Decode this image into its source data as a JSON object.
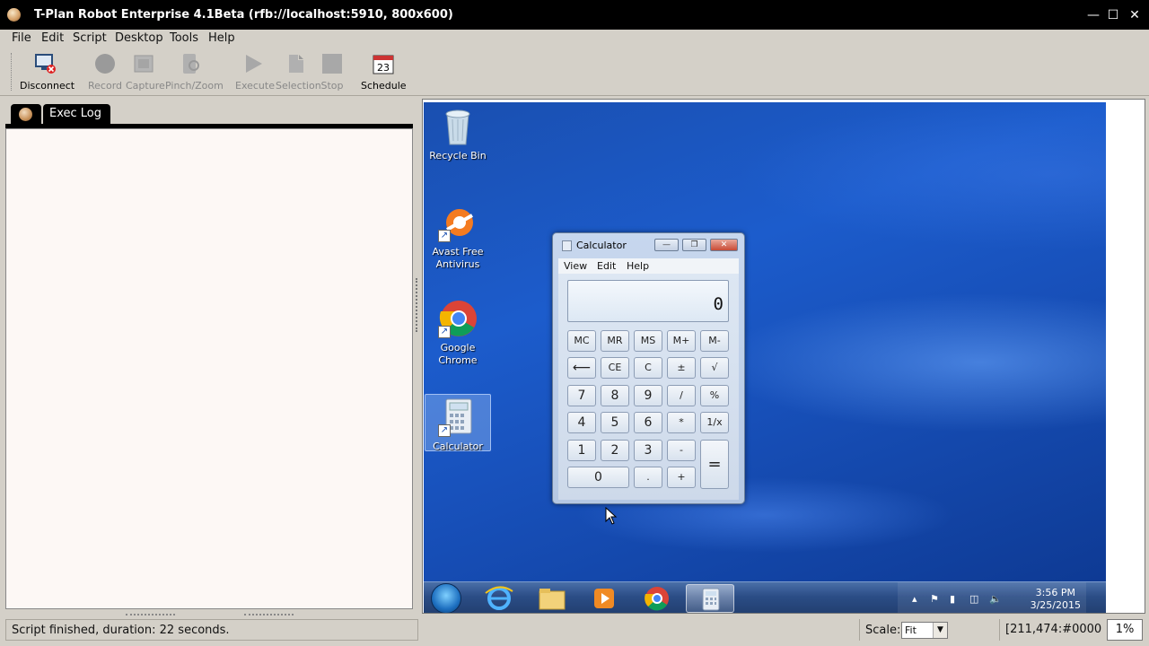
{
  "window": {
    "title": "T-Plan Robot Enterprise 4.1Beta (rfb://localhost:5910, 800x600)"
  },
  "menu": [
    "File",
    "Edit",
    "Script",
    "Desktop",
    "Tools",
    "Help"
  ],
  "toolbar": {
    "disconnect": "Disconnect",
    "record": "Record",
    "capture": "Capture",
    "pinch_zoom": "Pinch/Zoom",
    "execute": "Execute",
    "selection": "Selection",
    "stop": "Stop",
    "schedule": "Schedule",
    "schedule_day": "23"
  },
  "left_panel": {
    "tab_label": "Exec Log"
  },
  "desktop_icons": {
    "recycle_bin": "Recycle Bin",
    "avast_line1": "Avast Free",
    "avast_line2": "Antivirus",
    "chrome_line1": "Google",
    "chrome_line2": "Chrome",
    "calculator": "Calculator"
  },
  "calculator": {
    "title": "Calculator",
    "menu": [
      "View",
      "Edit",
      "Help"
    ],
    "display": "0",
    "memory": [
      "MC",
      "MR",
      "MS",
      "M+",
      "M-"
    ],
    "row2": [
      "⟵",
      "CE",
      "C",
      "±",
      "√"
    ],
    "row3": [
      "7",
      "8",
      "9",
      "/",
      "%"
    ],
    "row4": [
      "4",
      "5",
      "6",
      "*",
      "1/x"
    ],
    "row5": [
      "1",
      "2",
      "3",
      "-"
    ],
    "row6": [
      "0",
      ".",
      "+"
    ],
    "equals": "="
  },
  "taskbar": {
    "time": "3:56 PM",
    "date": "3/25/2015"
  },
  "status": {
    "message": "Script finished, duration: 22 seconds.",
    "scale_label": "Scale:",
    "scale_value": "Fit",
    "coordinates": "[211,474:#0000...",
    "zoom": "1%"
  },
  "colors": {
    "titlebar": "#000000",
    "desktop": "#1c5ccc",
    "taskbar": "#2b4d86"
  }
}
